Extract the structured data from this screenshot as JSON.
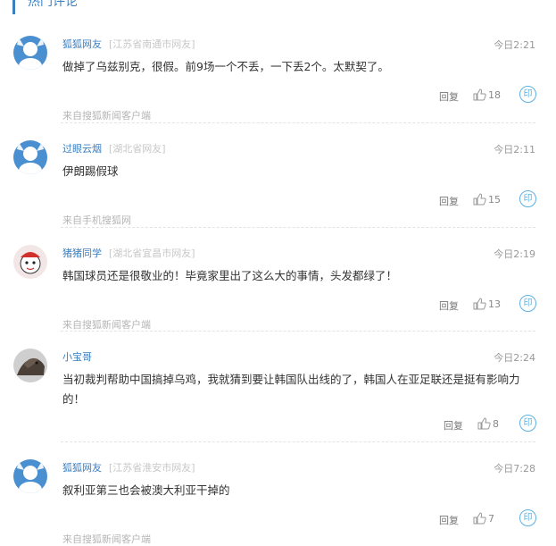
{
  "header": {
    "title": "热门评论"
  },
  "comments": [
    {
      "user": "狐狐网友",
      "location": "[江苏省南通市网友]",
      "time": "今日2:21",
      "text": "做掉了乌兹别克，很假。前9场一个不丢，一下丢2个。太默契了。",
      "source": "来自搜狐新闻客户端",
      "reply": "回复",
      "likes": "18",
      "share": "印",
      "avatar": "default-avatar-icon"
    },
    {
      "user": "过眼云烟",
      "location": "[湖北省网友]",
      "time": "今日2:11",
      "text": "伊朗踢假球",
      "source": "来自手机搜狐网",
      "reply": "回复",
      "likes": "15",
      "share": "印",
      "avatar": "default-avatar-icon"
    },
    {
      "user": "猪猪同学",
      "location": "[湖北省宜昌市网友]",
      "time": "今日2:19",
      "text": "韩国球员还是很敬业的！毕竟家里出了这么大的事情，头发都绿了！",
      "source": "来自搜狐新闻客户端",
      "reply": "回复",
      "likes": "13",
      "share": "印",
      "avatar": "cartoon-avatar-icon"
    },
    {
      "user": "小宝哥",
      "location": "",
      "time": "今日2:24",
      "text": "当初裁判帮助中国搞掉乌鸡，我就猜到要让韩国队出线的了，韩国人在亚足联还是挺有影响力的！",
      "source": "",
      "reply": "回复",
      "likes": "8",
      "share": "印",
      "avatar": "photo-avatar-icon"
    },
    {
      "user": "狐狐网友",
      "location": "[江苏省淮安市网友]",
      "time": "今日7:28",
      "text": "叙利亚第三也会被澳大利亚干掉的",
      "source": "来自搜狐新闻客户端",
      "reply": "回复",
      "likes": "7",
      "share": "印",
      "avatar": "default-avatar-icon"
    }
  ]
}
